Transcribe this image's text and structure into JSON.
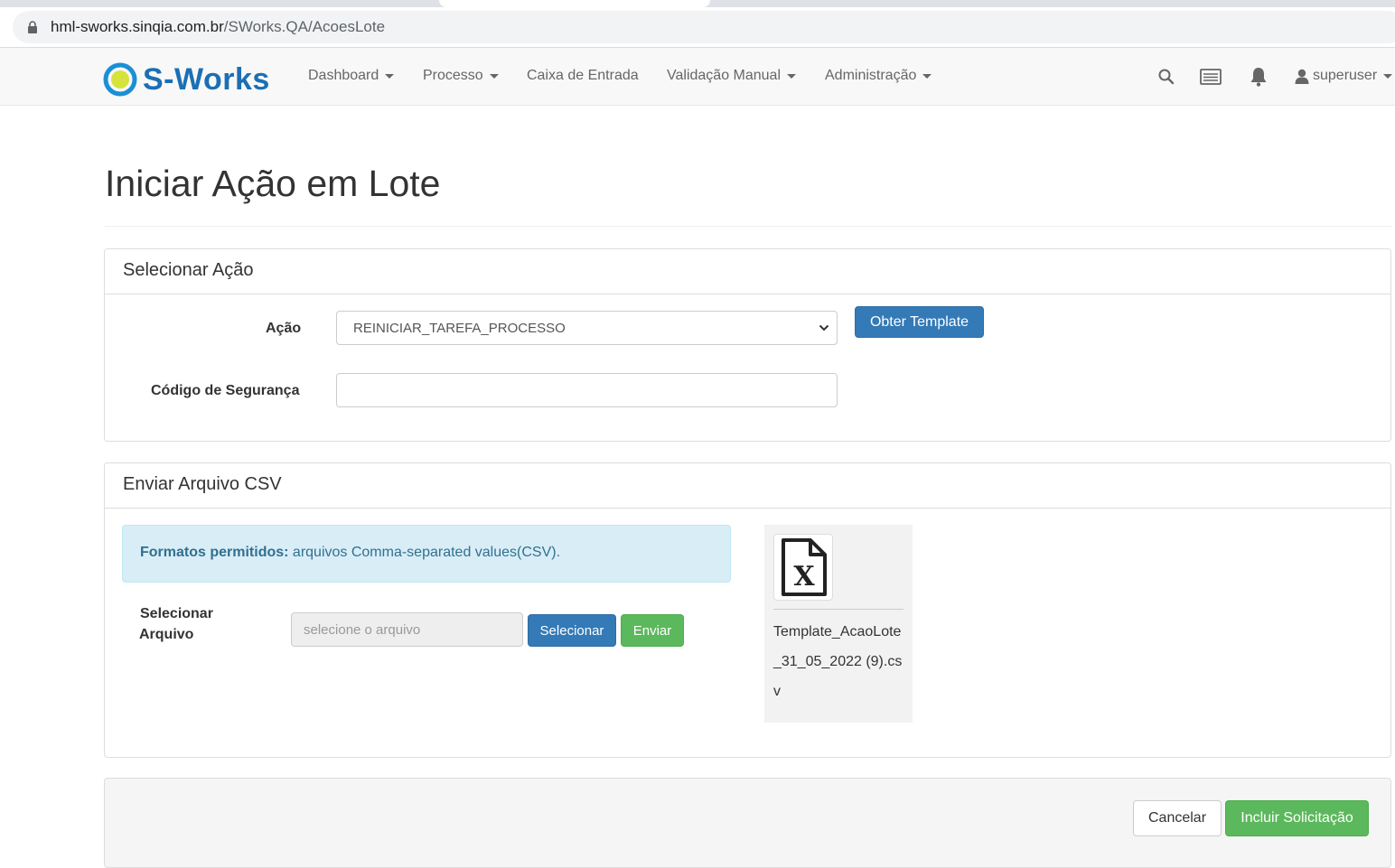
{
  "browser": {
    "url_host": "hml-sworks.sinqia.com.br",
    "url_path": "/SWorks.QA/AcoesLote"
  },
  "navbar": {
    "brand": "S-Works",
    "items": [
      {
        "label": "Dashboard",
        "dropdown": true
      },
      {
        "label": "Processo",
        "dropdown": true
      },
      {
        "label": "Caixa de Entrada",
        "dropdown": false
      },
      {
        "label": "Validação Manual",
        "dropdown": true
      },
      {
        "label": "Administração",
        "dropdown": true
      }
    ],
    "icons": [
      "search-icon",
      "list-icon",
      "bell-icon"
    ],
    "user": "superuser"
  },
  "page": {
    "title": "Iniciar Ação em Lote"
  },
  "select_action_panel": {
    "heading": "Selecionar Ação",
    "action_label": "Ação",
    "action_value": "REINICIAR_TAREFA_PROCESSO",
    "template_button": "Obter Template",
    "security_label": "Código de Segurança",
    "security_value": ""
  },
  "upload_panel": {
    "heading": "Enviar Arquivo CSV",
    "info_strong": "Formatos permitidos:",
    "info_text": " arquivos Comma-separated values(CSV).",
    "file_label_line1": "Selecionar",
    "file_label_line2": "Arquivo",
    "file_placeholder": "selecione o arquivo",
    "select_button": "Selecionar",
    "send_button": "Enviar",
    "file_name": "Template_AcaoLote_31_05_2022 (9).csv"
  },
  "footer": {
    "cancel_button": "Cancelar",
    "submit_button": "Incluir Solicitação"
  },
  "colors": {
    "primary": "#337ab7",
    "success": "#5cb85c",
    "info_bg": "#d9edf7",
    "brand_blue": "#1b6fb5"
  }
}
